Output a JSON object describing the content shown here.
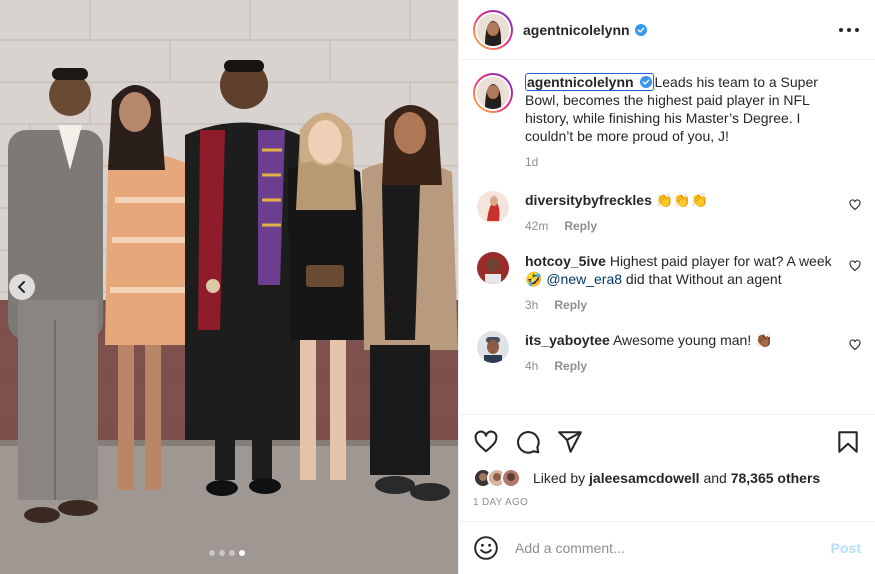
{
  "post": {
    "username": "agentnicolelynn",
    "verified": true,
    "carousel": {
      "total_slides": 4,
      "active_slide": 4
    },
    "caption": {
      "username": "agentnicolelynn",
      "text": "Leads his team to a Super Bowl, becomes the highest paid player in NFL history, while finishing his Master’s Degree. I couldn’t be more proud of you, J!",
      "age": "1d"
    },
    "comments": [
      {
        "username": "diversitybyfreckles",
        "text": "👏👏👏",
        "age": "42m",
        "reply_label": "Reply"
      },
      {
        "username": "hotcoy_5ive",
        "text_before": "Highest paid player for wat? A week 🤣 ",
        "mention": "@new_era8",
        "text_after": " did that Without an agent",
        "age": "3h",
        "reply_label": "Reply"
      },
      {
        "username": "its_yaboytee",
        "text": "Awesome young man! 👏🏾",
        "age": "4h",
        "reply_label": "Reply"
      }
    ],
    "likes": {
      "prefix": "Liked by ",
      "liked_by_user": "jaleesamcdowell",
      "conjunction": " and ",
      "others": "78,365 others"
    },
    "timestamp": "1 DAY AGO",
    "add_comment": {
      "placeholder": "Add a comment...",
      "post_label": "Post"
    },
    "colors": {
      "verified": "#3897f0",
      "link": "#00376b",
      "post_disabled": "#b2dffc",
      "muted": "#8e8e8e"
    }
  }
}
